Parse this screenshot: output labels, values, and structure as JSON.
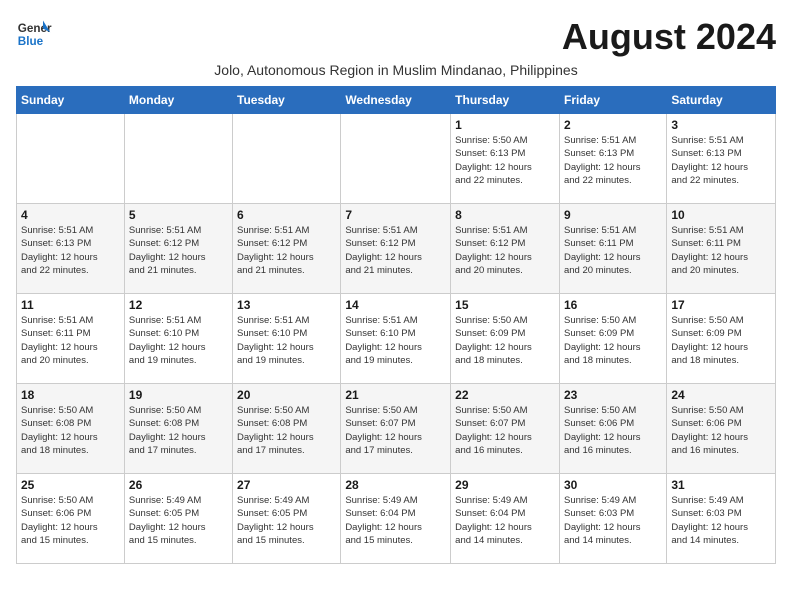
{
  "header": {
    "logo_line1": "General",
    "logo_line2": "Blue",
    "month_title": "August 2024",
    "subtitle": "Jolo, Autonomous Region in Muslim Mindanao, Philippines"
  },
  "days_of_week": [
    "Sunday",
    "Monday",
    "Tuesday",
    "Wednesday",
    "Thursday",
    "Friday",
    "Saturday"
  ],
  "weeks": [
    [
      {
        "day": "",
        "info": ""
      },
      {
        "day": "",
        "info": ""
      },
      {
        "day": "",
        "info": ""
      },
      {
        "day": "",
        "info": ""
      },
      {
        "day": "1",
        "info": "Sunrise: 5:50 AM\nSunset: 6:13 PM\nDaylight: 12 hours\nand 22 minutes."
      },
      {
        "day": "2",
        "info": "Sunrise: 5:51 AM\nSunset: 6:13 PM\nDaylight: 12 hours\nand 22 minutes."
      },
      {
        "day": "3",
        "info": "Sunrise: 5:51 AM\nSunset: 6:13 PM\nDaylight: 12 hours\nand 22 minutes."
      }
    ],
    [
      {
        "day": "4",
        "info": "Sunrise: 5:51 AM\nSunset: 6:13 PM\nDaylight: 12 hours\nand 22 minutes."
      },
      {
        "day": "5",
        "info": "Sunrise: 5:51 AM\nSunset: 6:12 PM\nDaylight: 12 hours\nand 21 minutes."
      },
      {
        "day": "6",
        "info": "Sunrise: 5:51 AM\nSunset: 6:12 PM\nDaylight: 12 hours\nand 21 minutes."
      },
      {
        "day": "7",
        "info": "Sunrise: 5:51 AM\nSunset: 6:12 PM\nDaylight: 12 hours\nand 21 minutes."
      },
      {
        "day": "8",
        "info": "Sunrise: 5:51 AM\nSunset: 6:12 PM\nDaylight: 12 hours\nand 20 minutes."
      },
      {
        "day": "9",
        "info": "Sunrise: 5:51 AM\nSunset: 6:11 PM\nDaylight: 12 hours\nand 20 minutes."
      },
      {
        "day": "10",
        "info": "Sunrise: 5:51 AM\nSunset: 6:11 PM\nDaylight: 12 hours\nand 20 minutes."
      }
    ],
    [
      {
        "day": "11",
        "info": "Sunrise: 5:51 AM\nSunset: 6:11 PM\nDaylight: 12 hours\nand 20 minutes."
      },
      {
        "day": "12",
        "info": "Sunrise: 5:51 AM\nSunset: 6:10 PM\nDaylight: 12 hours\nand 19 minutes."
      },
      {
        "day": "13",
        "info": "Sunrise: 5:51 AM\nSunset: 6:10 PM\nDaylight: 12 hours\nand 19 minutes."
      },
      {
        "day": "14",
        "info": "Sunrise: 5:51 AM\nSunset: 6:10 PM\nDaylight: 12 hours\nand 19 minutes."
      },
      {
        "day": "15",
        "info": "Sunrise: 5:50 AM\nSunset: 6:09 PM\nDaylight: 12 hours\nand 18 minutes."
      },
      {
        "day": "16",
        "info": "Sunrise: 5:50 AM\nSunset: 6:09 PM\nDaylight: 12 hours\nand 18 minutes."
      },
      {
        "day": "17",
        "info": "Sunrise: 5:50 AM\nSunset: 6:09 PM\nDaylight: 12 hours\nand 18 minutes."
      }
    ],
    [
      {
        "day": "18",
        "info": "Sunrise: 5:50 AM\nSunset: 6:08 PM\nDaylight: 12 hours\nand 18 minutes."
      },
      {
        "day": "19",
        "info": "Sunrise: 5:50 AM\nSunset: 6:08 PM\nDaylight: 12 hours\nand 17 minutes."
      },
      {
        "day": "20",
        "info": "Sunrise: 5:50 AM\nSunset: 6:08 PM\nDaylight: 12 hours\nand 17 minutes."
      },
      {
        "day": "21",
        "info": "Sunrise: 5:50 AM\nSunset: 6:07 PM\nDaylight: 12 hours\nand 17 minutes."
      },
      {
        "day": "22",
        "info": "Sunrise: 5:50 AM\nSunset: 6:07 PM\nDaylight: 12 hours\nand 16 minutes."
      },
      {
        "day": "23",
        "info": "Sunrise: 5:50 AM\nSunset: 6:06 PM\nDaylight: 12 hours\nand 16 minutes."
      },
      {
        "day": "24",
        "info": "Sunrise: 5:50 AM\nSunset: 6:06 PM\nDaylight: 12 hours\nand 16 minutes."
      }
    ],
    [
      {
        "day": "25",
        "info": "Sunrise: 5:50 AM\nSunset: 6:06 PM\nDaylight: 12 hours\nand 15 minutes."
      },
      {
        "day": "26",
        "info": "Sunrise: 5:49 AM\nSunset: 6:05 PM\nDaylight: 12 hours\nand 15 minutes."
      },
      {
        "day": "27",
        "info": "Sunrise: 5:49 AM\nSunset: 6:05 PM\nDaylight: 12 hours\nand 15 minutes."
      },
      {
        "day": "28",
        "info": "Sunrise: 5:49 AM\nSunset: 6:04 PM\nDaylight: 12 hours\nand 15 minutes."
      },
      {
        "day": "29",
        "info": "Sunrise: 5:49 AM\nSunset: 6:04 PM\nDaylight: 12 hours\nand 14 minutes."
      },
      {
        "day": "30",
        "info": "Sunrise: 5:49 AM\nSunset: 6:03 PM\nDaylight: 12 hours\nand 14 minutes."
      },
      {
        "day": "31",
        "info": "Sunrise: 5:49 AM\nSunset: 6:03 PM\nDaylight: 12 hours\nand 14 minutes."
      }
    ]
  ]
}
